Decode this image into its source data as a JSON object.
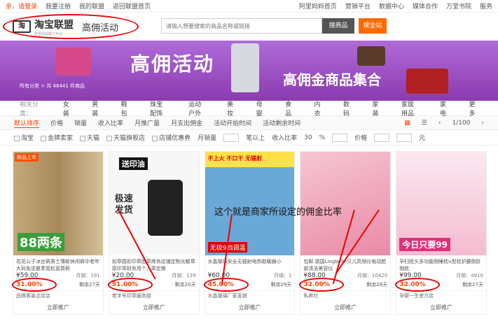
{
  "topbar": {
    "login": "亲，请登录",
    "links": [
      "我要注册",
      "我的联盟",
      "返回联盟首页"
    ],
    "right": [
      "阿里妈妈首页",
      "营销平台",
      "数据中心",
      "媒体合作",
      "万堂书院",
      "服务"
    ]
  },
  "header": {
    "logo_text": "淘宝联盟",
    "logo_sub": "阿里妈妈旗下平台",
    "page_title": "高佣活动",
    "search_placeholder": "请输入想要搜索的商品名称或链接",
    "search_button": "搜商品",
    "search_all_button": "搜全站"
  },
  "banner": {
    "title": "高佣活动",
    "subtitle": "高佣金商品集合",
    "crumb": "所有分类 > 共 46441 件商品"
  },
  "categories": {
    "label": "相关分类：",
    "items": [
      "女装",
      "男装",
      "鞋包",
      "珠宝配饰",
      "运动户外",
      "美妆",
      "母婴",
      "食品",
      "内衣",
      "数码",
      "家装",
      "家居用品",
      "家电"
    ],
    "more": "更多"
  },
  "sortbar": {
    "items": [
      "默认排序",
      "价格",
      "销量",
      "收入比率",
      "月推广量",
      "月支出佣金",
      "活动开始时间",
      "活动剩余时间"
    ],
    "page": "1/100"
  },
  "filterbar": {
    "items": [
      "淘宝",
      "金牌卖家",
      "天猫",
      "天猫旗舰店",
      "店铺优惠券",
      "月销量",
      "笔以上",
      "收入比率",
      "30",
      "%",
      "价格",
      "元"
    ]
  },
  "overlay_text": "这个就是商家所设定的佣金比率",
  "products": [
    {
      "title": "花花公子冰丝裤男士薄款休闲裤中老年大码免烫夏季宽松直筒裤",
      "price": "¥59.00",
      "sold": "月销：191",
      "rate": "31.00%",
      "rebate": "剩余27天",
      "shop": "品牌男装北京店",
      "promo": "立即推广",
      "ad": "立即推广",
      "tag": "新品上市",
      "big": "88两条"
    },
    {
      "title": "刻章圆形印章图章商务店铺定制光敏章原印章财务用个人章定做",
      "price": "¥20.00",
      "sold": "月销：139",
      "rate": "51.00%",
      "rebate": "剩余20天",
      "shop": "老字号印章服务部",
      "promo": "立即推广",
      "ad": "立即推广",
      "tag": "送印油",
      "big": "极速发货"
    },
    {
      "title": "水晶玻璃安全无辐射电热取暖器小",
      "price": "¥60.00",
      "sold": "月销：1",
      "rate": "45.00%",
      "rebate": "剩余29天",
      "shop": "水晶玻璃厂家直销",
      "promo": "立即推广",
      "ad": "立即推广",
      "tag": "不上火 不口干 无辐射",
      "big": "无极9档调温"
    },
    {
      "title": "包邮 德国Lingbelle贝儿高频仪电动脸部清洁美容仪",
      "price": "¥88.00",
      "sold": "月销：10420",
      "rate": "32.00%",
      "rebate": "剩余28天",
      "shop": "私奔社",
      "promo": "立即推广",
      "ad": "立即推广",
      "tag": "",
      "big": ""
    },
    {
      "title": "孕妇枕头多功能侧睡枕u型枕护腰侧卧抱枕",
      "price": "¥99.00",
      "sold": "月销：4910",
      "rate": "32.00%",
      "rebate": "剩余27天",
      "shop": "孕婴一生官方店",
      "promo": "立即推广",
      "ad": "立即推广",
      "tag": "",
      "big": "今日只要99"
    }
  ],
  "colors": {
    "accent": "#ff6a00",
    "highlight": "#e00000",
    "banner": "#9b4fc6"
  }
}
